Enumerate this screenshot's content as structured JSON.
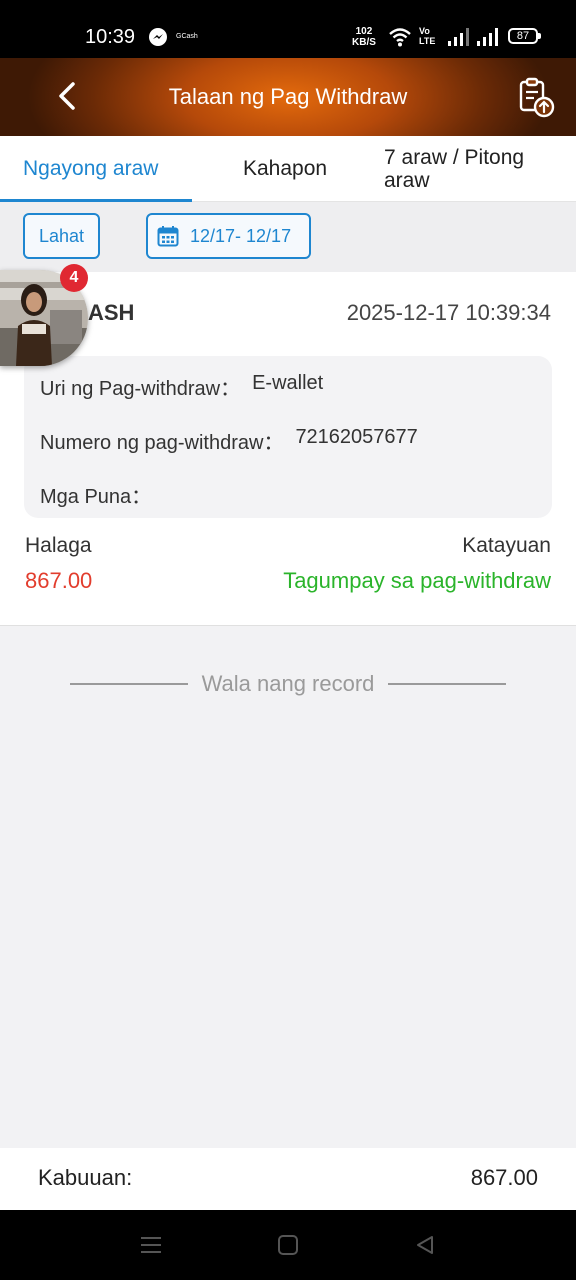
{
  "status_bar": {
    "time": "10:39",
    "notification_app": "GCash",
    "net_speed_value": "102",
    "net_speed_unit": "KB/S",
    "volte_top": "Vo",
    "volte_bottom": "LTE",
    "battery": "87",
    "icons": [
      "messenger-icon",
      "wifi-icon",
      "volte-icon",
      "signal-icon",
      "signal-icon",
      "battery-icon"
    ]
  },
  "header": {
    "title": "Talaan ng Pag Withdraw",
    "back_icon": "chevron-left-icon",
    "action_icon": "clipboard-upload-icon",
    "accent": "#e36a0c"
  },
  "tabs": [
    {
      "label": "Ngayong araw",
      "active": true
    },
    {
      "label": "Kahapon",
      "active": false
    },
    {
      "label": "7 araw / Pitong araw",
      "active": false
    }
  ],
  "filters": {
    "all_label": "Lahat",
    "date_range": "12/17- 12/17"
  },
  "record": {
    "method": "ASH",
    "datetime": "2025-12-17 10:39:34",
    "type_label": "Uri ng Pag-withdraw：",
    "type_value": "E-wallet",
    "number_label": "Numero ng pag-withdraw：",
    "number_value": "72162057677",
    "remarks_label": "Mga Puna：",
    "remarks_value": "",
    "amount_label": "Halaga",
    "amount_value": "867.00",
    "status_label": "Katayuan",
    "status_value": "Tagumpay sa pag-withdraw",
    "amount_color": "#e23d2d",
    "status_color": "#2bb42b"
  },
  "floating_avatar": {
    "badge_count": "4"
  },
  "empty_text": "Wala nang record",
  "total": {
    "label": "Kabuuan:",
    "value": "867.00"
  }
}
